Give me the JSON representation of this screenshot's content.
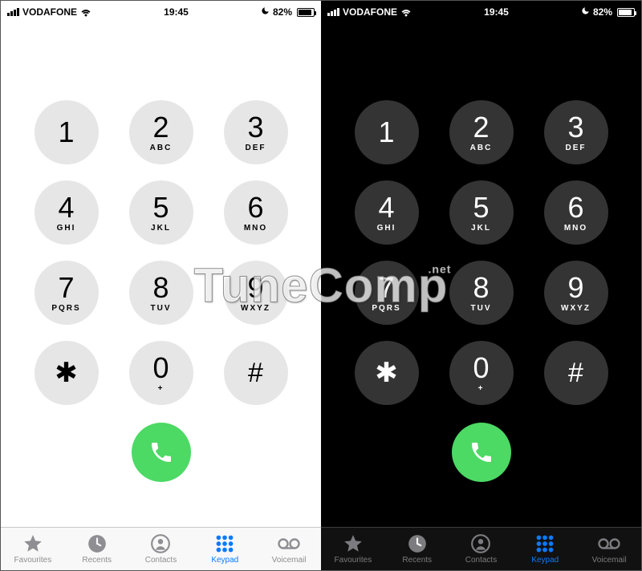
{
  "statusbar": {
    "carrier": "VODAFONE",
    "time": "19:45",
    "battery_pct": "82%"
  },
  "keypad": [
    {
      "digit": "1",
      "letters": ""
    },
    {
      "digit": "2",
      "letters": "ABC"
    },
    {
      "digit": "3",
      "letters": "DEF"
    },
    {
      "digit": "4",
      "letters": "GHI"
    },
    {
      "digit": "5",
      "letters": "JKL"
    },
    {
      "digit": "6",
      "letters": "MNO"
    },
    {
      "digit": "7",
      "letters": "PQRS"
    },
    {
      "digit": "8",
      "letters": "TUV"
    },
    {
      "digit": "9",
      "letters": "WXYZ"
    },
    {
      "digit": "✱",
      "letters": ""
    },
    {
      "digit": "0",
      "letters": "+"
    },
    {
      "digit": "#",
      "letters": ""
    }
  ],
  "tabs": [
    {
      "id": "favourites",
      "label": "Favourites",
      "active": false
    },
    {
      "id": "recents",
      "label": "Recents",
      "active": false
    },
    {
      "id": "contacts",
      "label": "Contacts",
      "active": false
    },
    {
      "id": "keypad",
      "label": "Keypad",
      "active": true
    },
    {
      "id": "voicemail",
      "label": "Voicemail",
      "active": false
    }
  ],
  "watermark": {
    "text": "TuneComp",
    "suffix": ".net"
  },
  "colors": {
    "call_green": "#4cd964",
    "ios_blue": "#0a7aff"
  }
}
